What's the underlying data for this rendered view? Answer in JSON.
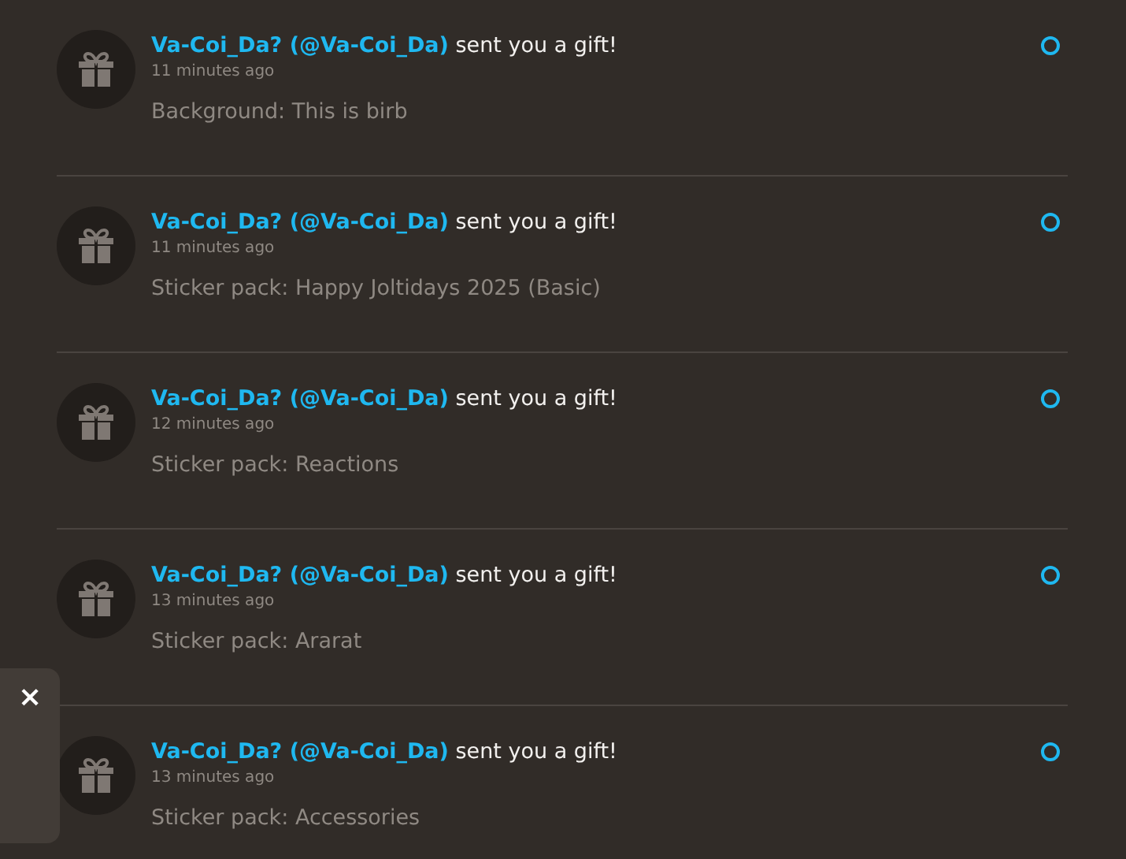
{
  "notifications": [
    {
      "sender": "Va-Coi_Da? (@Va-Coi_Da)",
      "action": "sent you a gift!",
      "time": "11 minutes ago",
      "detail": "Background: This is birb",
      "unread": true
    },
    {
      "sender": "Va-Coi_Da? (@Va-Coi_Da)",
      "action": "sent you a gift!",
      "time": "11 minutes ago",
      "detail": "Sticker pack: Happy Joltidays 2025 (Basic)",
      "unread": true
    },
    {
      "sender": "Va-Coi_Da? (@Va-Coi_Da)",
      "action": "sent you a gift!",
      "time": "12 minutes ago",
      "detail": "Sticker pack: Reactions",
      "unread": true
    },
    {
      "sender": "Va-Coi_Da? (@Va-Coi_Da)",
      "action": "sent you a gift!",
      "time": "13 minutes ago",
      "detail": "Sticker pack: Ararat",
      "unread": true
    },
    {
      "sender": "Va-Coi_Da? (@Va-Coi_Da)",
      "action": "sent you a gift!",
      "time": "13 minutes ago",
      "detail": "Sticker pack: Accessories",
      "unread": true
    }
  ],
  "close_label": "×"
}
